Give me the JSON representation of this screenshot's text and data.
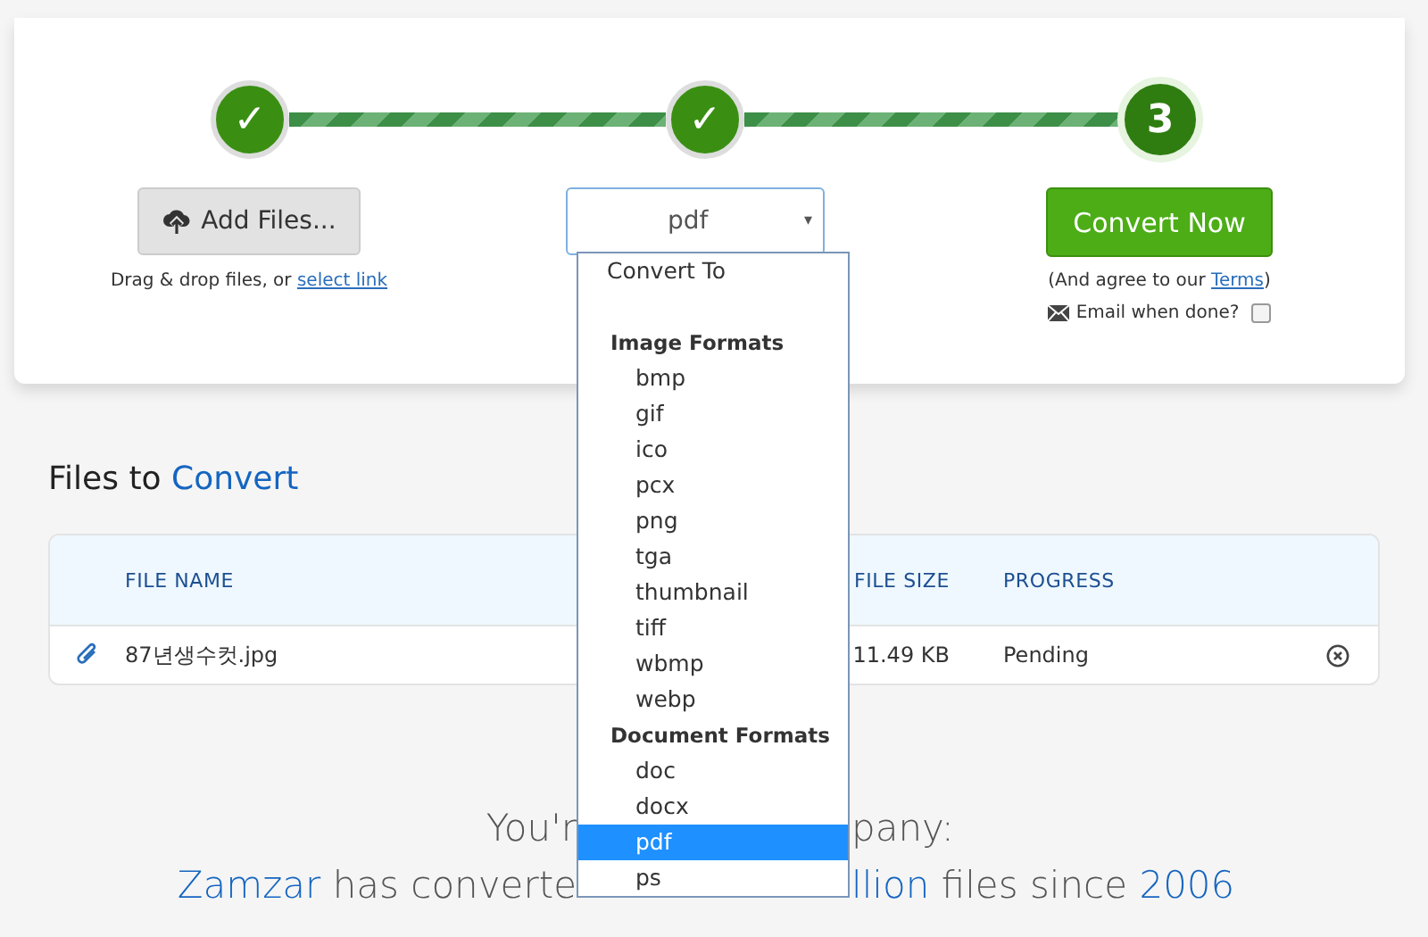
{
  "steps": [
    {
      "kind": "done",
      "label": "✓"
    },
    {
      "kind": "done",
      "label": "✓"
    },
    {
      "kind": "current",
      "label": "3"
    }
  ],
  "add_files": {
    "label": "Add Files...",
    "hint": "Drag & drop files, or ",
    "hint_link": "select link"
  },
  "format_select": {
    "value": "pdf",
    "caret": "▾",
    "expanded": true
  },
  "convert": {
    "label": "Convert Now",
    "terms_before": "(And agree to our ",
    "terms_link": "Terms",
    "terms_after": ")",
    "email_label": "Email when done?",
    "email_checked": false
  },
  "dropdown": [
    {
      "kind": "option",
      "label": "Convert To",
      "selected": false
    },
    {
      "kind": "spacer"
    },
    {
      "kind": "group",
      "label": "Image Formats"
    },
    {
      "kind": "option",
      "label": "bmp",
      "selected": false
    },
    {
      "kind": "option",
      "label": "gif",
      "selected": false
    },
    {
      "kind": "option",
      "label": "ico",
      "selected": false
    },
    {
      "kind": "option",
      "label": "pcx",
      "selected": false
    },
    {
      "kind": "option",
      "label": "png",
      "selected": false
    },
    {
      "kind": "option",
      "label": "tga",
      "selected": false
    },
    {
      "kind": "option",
      "label": "thumbnail",
      "selected": false
    },
    {
      "kind": "option",
      "label": "tiff",
      "selected": false
    },
    {
      "kind": "option",
      "label": "wbmp",
      "selected": false
    },
    {
      "kind": "option",
      "label": "webp",
      "selected": false
    },
    {
      "kind": "group",
      "label": "Document Formats"
    },
    {
      "kind": "option",
      "label": "doc",
      "selected": false
    },
    {
      "kind": "option",
      "label": "docx",
      "selected": false
    },
    {
      "kind": "option",
      "label": "pdf",
      "selected": true
    },
    {
      "kind": "option",
      "label": "ps",
      "selected": false
    }
  ],
  "files": {
    "title": "Files to",
    "title_accent": "Convert",
    "columns": [
      "FILE NAME",
      "FILE SIZE",
      "PROGRESS"
    ],
    "rows": [
      {
        "name": "87년생수컷.jpg",
        "size": "11.49 KB",
        "progress": "Pending"
      }
    ]
  },
  "footer": {
    "line_1_left": "You'r",
    "line_1_right": "pany:",
    "line_2_left_accent": "Zamzar",
    "line_2_left": "has converte",
    "line_2_right_accent": "llion",
    "line_2_right": "files since",
    "line_2_year": "2006"
  }
}
